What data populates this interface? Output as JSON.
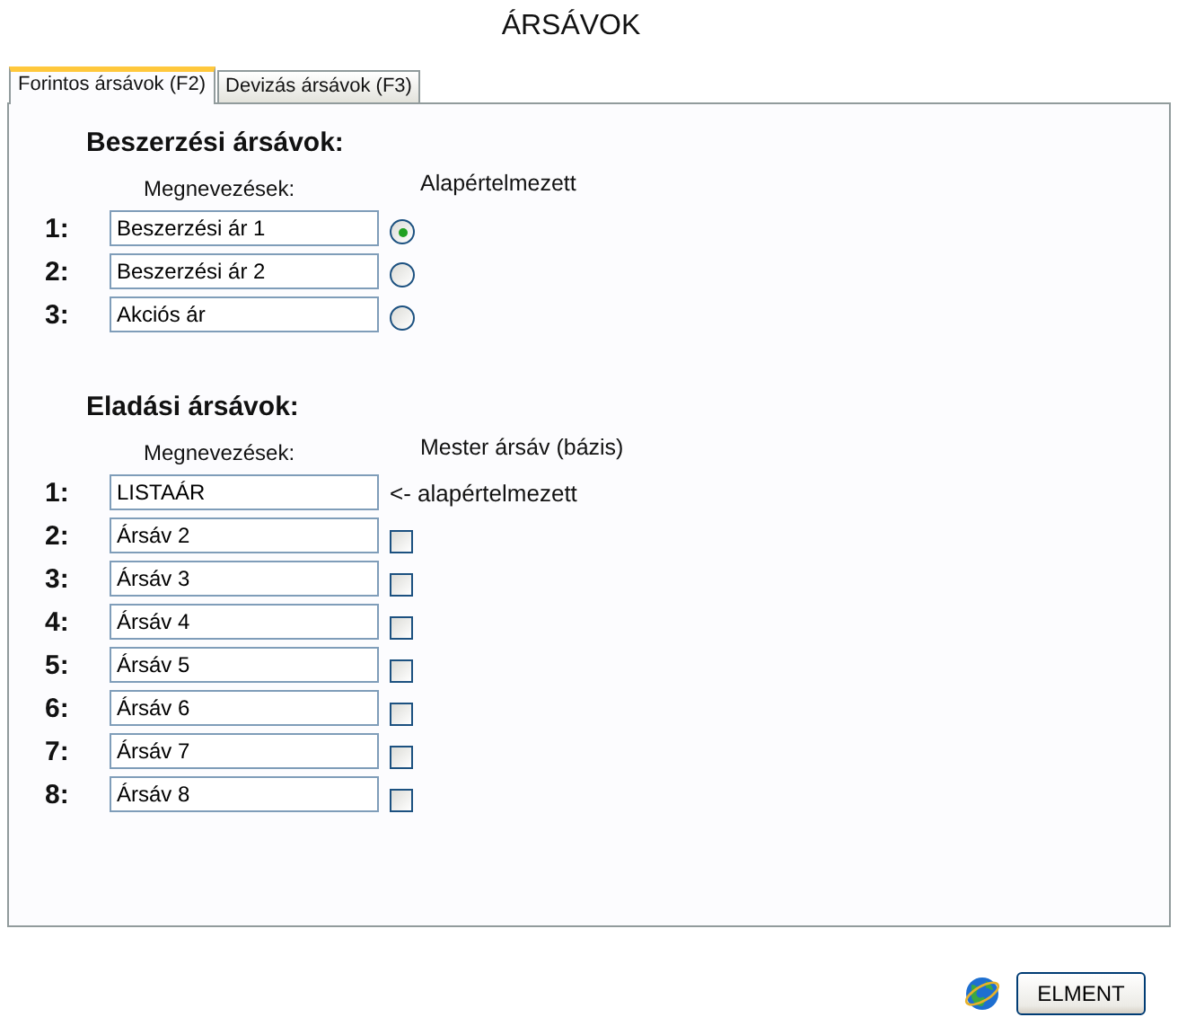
{
  "title": "ÁRSÁVOK",
  "tabs": [
    {
      "label": "Forintos ársávok (F2)",
      "selected": true
    },
    {
      "label": "Devizás ársávok (F3)",
      "selected": false
    }
  ],
  "purchase": {
    "heading": "Beszerzési ársávok:",
    "names_header": "Megnevezések:",
    "default_header": "Alapértelmezett",
    "rows": [
      {
        "number": "1:",
        "value": "Beszerzési ár 1",
        "selected": true
      },
      {
        "number": "2:",
        "value": "Beszerzési ár 2",
        "selected": false
      },
      {
        "number": "3:",
        "value": "Akciós ár",
        "selected": false
      }
    ]
  },
  "sales": {
    "heading": "Eladási ársávok:",
    "names_header": "Megnevezések:",
    "master_header": "Mester ársáv (bázis)",
    "rows": [
      {
        "number": "1:",
        "value": "LISTAÁR",
        "kind": "note",
        "note": "<- alapértelmezett"
      },
      {
        "number": "2:",
        "value": "Ársáv 2",
        "kind": "checkbox",
        "checked": false
      },
      {
        "number": "3:",
        "value": "Ársáv 3",
        "kind": "checkbox",
        "checked": false
      },
      {
        "number": "4:",
        "value": "Ársáv 4",
        "kind": "checkbox",
        "checked": false
      },
      {
        "number": "5:",
        "value": "Ársáv 5",
        "kind": "checkbox",
        "checked": false
      },
      {
        "number": "6:",
        "value": "Ársáv 6",
        "kind": "checkbox",
        "checked": false
      },
      {
        "number": "7:",
        "value": "Ársáv 7",
        "kind": "checkbox",
        "checked": false
      },
      {
        "number": "8:",
        "value": "Ársáv 8",
        "kind": "checkbox",
        "checked": false
      }
    ]
  },
  "save_button": "ELMENT"
}
